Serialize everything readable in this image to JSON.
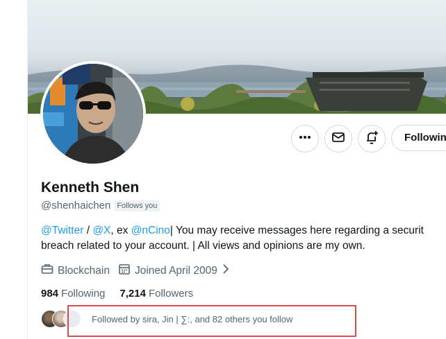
{
  "profile": {
    "name": "Kenneth Shen",
    "handle": "@shenhaichen",
    "follows_you": "Follows you",
    "bio": {
      "link1": "@Twitter",
      "sep1": " / ",
      "link2": "@X",
      "text1": ", ex ",
      "link3": "@nCino",
      "text2": "| You may receive messages here regarding a securit",
      "line2": "breach related to your account. | All views and opinions are my own."
    },
    "category": "Blockchain",
    "joined": "Joined April 2009",
    "following_count": "984",
    "following_label": "Following",
    "followers_count": "7,214",
    "followers_label": "Followers",
    "followed_by": "Followed by sira, Jin | ∑:, and 82 others you follow"
  },
  "actions": {
    "more_icon": "more-icon",
    "message_icon": "envelope-icon",
    "notify_icon": "bell-plus-icon",
    "follow_label": "Following"
  },
  "colors": {
    "accent": "#1d9bf0",
    "muted_text": "#536471",
    "highlight_border": "#e0484b"
  }
}
